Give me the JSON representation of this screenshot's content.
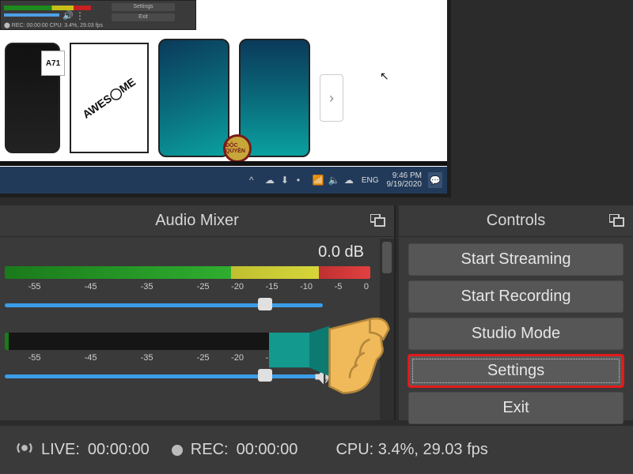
{
  "preview": {
    "mini": {
      "btn1": "Settings",
      "btn2": "Exit",
      "status": "⬤  REC: 00:00:00   CPU: 3.4%, 29.03 fps"
    },
    "phones": {
      "a71_badge": "A71",
      "awesome": "AWES◯ME",
      "next_arrow": "›",
      "stamp": "ĐỘC QUYỀN"
    },
    "taskbar": {
      "tray_up": "^",
      "lang": "ENG",
      "clock_time": "9:46 PM",
      "clock_date": "9/19/2020"
    }
  },
  "mixer": {
    "title": "Audio Mixer",
    "db_value": "0.0 dB",
    "ticks": [
      "",
      "-55",
      "",
      "-45",
      "",
      "-35",
      "",
      "-25",
      "-20",
      "-15",
      "-10",
      "-5",
      "0"
    ]
  },
  "controls": {
    "title": "Controls",
    "buttons": {
      "stream": "Start Streaming",
      "record": "Start Recording",
      "studio": "Studio Mode",
      "settings": "Settings",
      "exit": "Exit"
    }
  },
  "status": {
    "live_label": "LIVE:",
    "live_time": "00:00:00",
    "rec_label": "REC:",
    "rec_time": "00:00:00",
    "cpu": "CPU: 3.4%, 29.03 fps"
  }
}
